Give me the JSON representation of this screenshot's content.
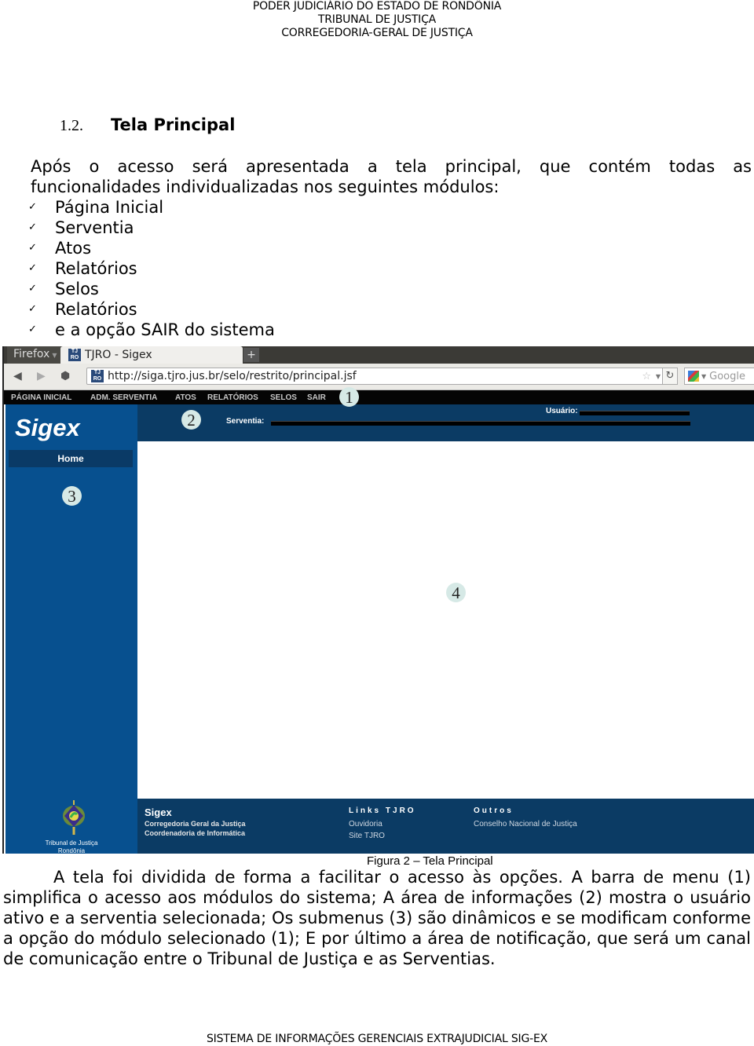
{
  "doc_header": {
    "line1": "PODER JUDICIÁRIO DO ESTADO DE RONDÔNIA",
    "line2": "TRIBUNAL DE JUSTIÇA",
    "line3": "CORREGEDORIA-GERAL DE JUSTIÇA"
  },
  "section": {
    "number": "1.2.",
    "title": "Tela Principal"
  },
  "intro": {
    "line1": "Após o acesso será apresentada a tela principal, que contém todas as",
    "line2": "funcionalidades individualizadas nos seguintes módulos:"
  },
  "modules": [
    {
      "label": "Página Inicial"
    },
    {
      "label": "Serventia"
    },
    {
      "label": "Atos"
    },
    {
      "label": "Relatórios"
    },
    {
      "label": "Selos"
    },
    {
      "label": "Relatórios"
    },
    {
      "label": "e a opção SAIR do sistema"
    }
  ],
  "screenshot": {
    "browser": {
      "app_button": "Firefox",
      "tab_title": "TJRO - Sigex",
      "favicon_text": "TJ RO",
      "new_tab": "+",
      "url": "http://siga.tjro.jus.br/selo/restrito/principal.jsf",
      "search_placeholder": "Google"
    },
    "menu": [
      {
        "label": "PÁGINA INICIAL"
      },
      {
        "label": "ADM. SERVENTIA"
      },
      {
        "label": "ATOS"
      },
      {
        "label": "RELATÓRIOS"
      },
      {
        "label": "SELOS"
      },
      {
        "label": "SAIR"
      }
    ],
    "app": {
      "logo": "Sigex",
      "usuario_label": "Usuário:",
      "serventia_label": "Serventia:",
      "submenu": [
        {
          "label": "Home"
        }
      ]
    },
    "footer": {
      "seal_line1": "Tribunal de Justiça",
      "seal_line2": "Rondônia",
      "title": "Sigex",
      "sub1": "Corregedoria Geral da Justiça",
      "sub2": "Coordenadoria de Informática",
      "links_heading": "Links TJRO",
      "links": [
        {
          "label": "Ouvidoria"
        },
        {
          "label": "Site TJRO"
        }
      ],
      "others_heading": "Outros",
      "others": [
        {
          "label": "Conselho Nacional de Justiça"
        }
      ]
    },
    "callouts": [
      "1",
      "2",
      "3",
      "4"
    ]
  },
  "caption": "Figura 2 – Tela Principal",
  "body_text": "A tela foi dividida de forma a facilitar o acesso às opções. A barra de menu (1) simplifica o acesso aos módulos do sistema; A área de informações (2) mostra o usuário ativo e a serventia selecionada; Os submenus (3) são dinâmicos e se modificam conforme a opção do módulo selecionado (1); E por último a área de notificação, que será um canal de comunicação entre o Tribunal de Justiça e as Serventias.",
  "doc_footer": "SISTEMA DE INFORMAÇÕES GERENCIAIS EXTRAJUDICIAL SIG-EX"
}
